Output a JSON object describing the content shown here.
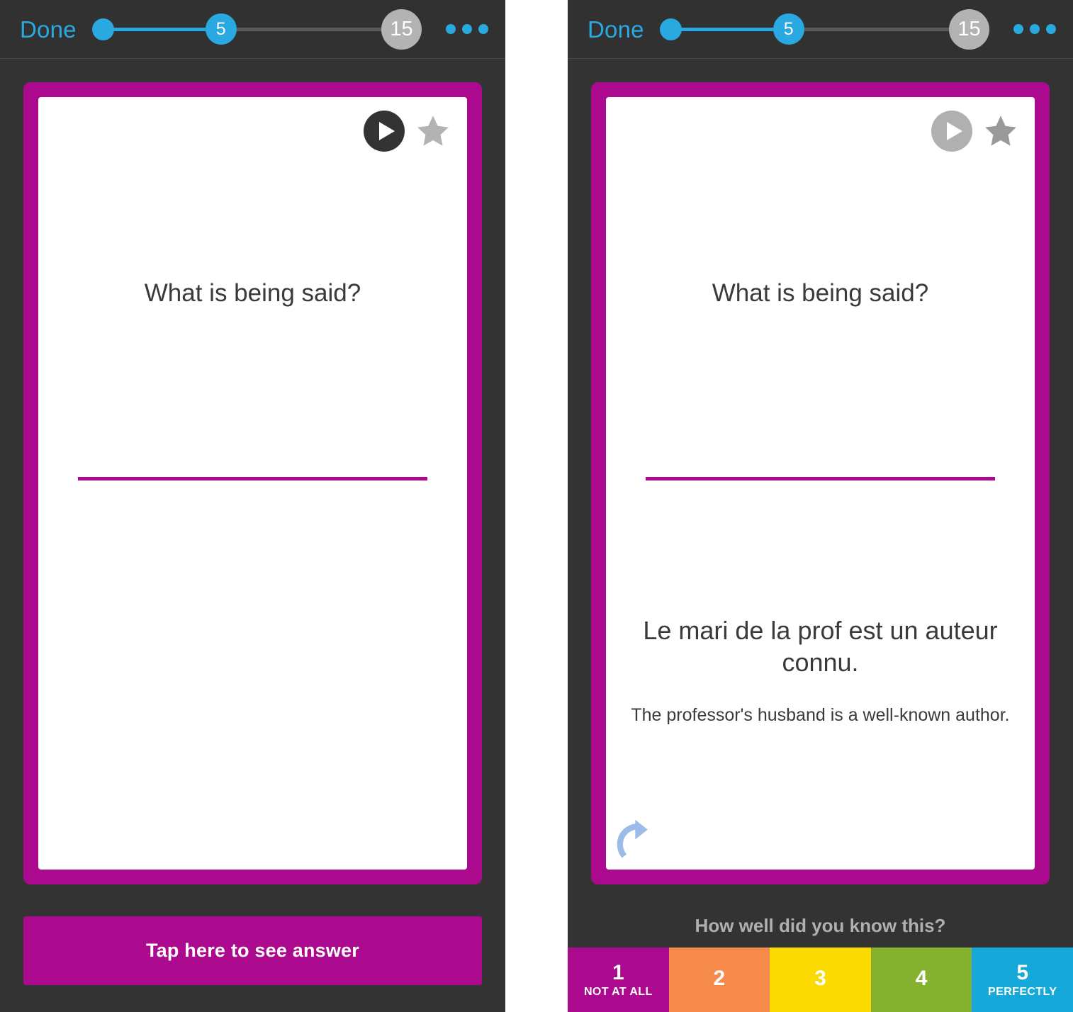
{
  "app": {
    "background_color": "#333333",
    "accent_magenta": "#ab0a8f",
    "accent_blue": "#2aa8e0"
  },
  "topbar": {
    "done_label": "Done",
    "slider": {
      "current_value": "5",
      "total_value": "15",
      "knob_start_name": "slider-start-knob"
    },
    "more_label": "•••"
  },
  "panels": [
    {
      "id": "question-side",
      "card": {
        "play_icon": "play-icon",
        "play_state": "enabled",
        "star_icon": "star-icon",
        "star_state": "unstarred",
        "star_color": "#b3b3b3",
        "question": "What is being said?",
        "answer_main": "",
        "answer_sub": "",
        "undo_visible": false
      },
      "footer": {
        "type": "tap-button",
        "tap_label": "Tap here to see answer"
      }
    },
    {
      "id": "answer-side",
      "card": {
        "play_icon": "play-icon",
        "play_state": "disabled",
        "star_icon": "star-icon",
        "star_state": "unstarred",
        "star_color": "#9a9a9a",
        "question": "What is being said?",
        "answer_main": "Le mari de la prof est un auteur connu.",
        "answer_sub": "The professor's husband is a well-known author.",
        "undo_visible": true,
        "undo_icon": "undo-arrow-icon",
        "undo_color": "#9dbbe8"
      },
      "footer": {
        "type": "rating-bar",
        "prompt": "How well did you know this?",
        "options": [
          {
            "number": "1",
            "caption": "NOT AT ALL",
            "color": "#ab0a8f"
          },
          {
            "number": "2",
            "caption": "",
            "color": "#f58a4b"
          },
          {
            "number": "3",
            "caption": "",
            "color": "#fada00"
          },
          {
            "number": "4",
            "caption": "",
            "color": "#84b22e"
          },
          {
            "number": "5",
            "caption": "PERFECTLY",
            "color": "#16a8d8"
          }
        ]
      }
    }
  ]
}
